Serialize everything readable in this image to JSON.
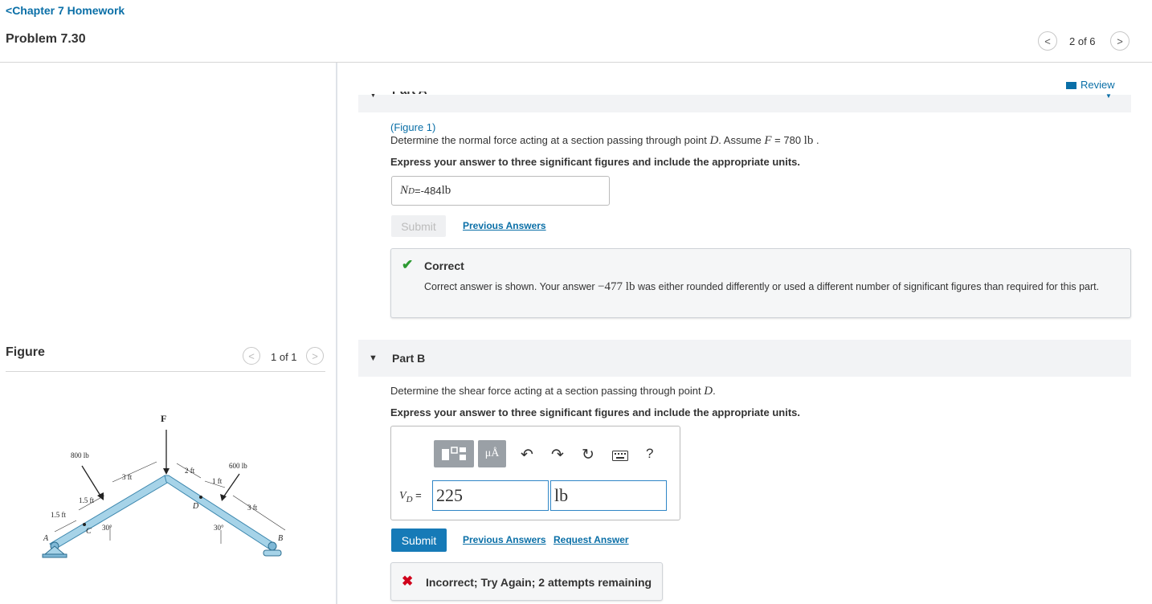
{
  "header": {
    "breadcrumb": "Chapter 7 Homework",
    "problem_title": "Problem 7.30",
    "pagination": "2 of 6"
  },
  "figure_panel": {
    "label": "Figure",
    "count": "1 of 1",
    "diagram_labels": {
      "force_F": "F",
      "load_left": "800 lb",
      "load_right": "600 lb",
      "dim_3ft_left": "3 ft",
      "dim_2ft": "2 ft",
      "dim_1ft": "1 ft",
      "dim_3ft_right": "3 ft",
      "dim_15ft_a": "1.5 ft",
      "dim_15ft_b": "1.5 ft",
      "angle_left": "30°",
      "angle_right": "30°",
      "point_A": "A",
      "point_B": "B",
      "point_C": "C",
      "point_D": "D"
    }
  },
  "review_link": "Review",
  "part_a": {
    "title": "Part A",
    "figure_link": "(Figure 1)",
    "question_pre": "Determine the normal force acting at a section passing through point ",
    "question_point": "D",
    "question_mid": ". Assume ",
    "question_var": "F",
    "question_eq": " = 780 ",
    "question_unit": "lb",
    "question_end": " .",
    "instruction": "Express your answer to three significant figures and include the appropriate units.",
    "answer_symbol": "N",
    "answer_sub": "D",
    "answer_eq": " = ",
    "answer_value": "-484 ",
    "answer_unit": "lb",
    "submit_label": "Submit",
    "previous_answers": "Previous Answers",
    "feedback": {
      "title": "Correct",
      "msg_pre": "Correct answer is shown. Your answer ",
      "msg_value": "−477 lb",
      "msg_post": " was either rounded differently or used a different number of significant figures than required for this part."
    }
  },
  "part_b": {
    "title": "Part B",
    "question_pre": "Determine the shear force acting at a section passing through point ",
    "question_point": "D",
    "question_end": ".",
    "instruction": "Express your answer to three significant figures and include the appropriate units.",
    "units_button": "μÅ",
    "help_label": "?",
    "answer_symbol": "V",
    "answer_sub": "D",
    "answer_eq": " = ",
    "value_input": "225",
    "unit_input": "lb",
    "submit_label": "Submit",
    "previous_answers": "Previous Answers",
    "request_answer": "Request Answer",
    "feedback": "Incorrect; Try Again; 2 attempts remaining"
  },
  "colors": {
    "link": "#0a6fa7",
    "submit_active": "#167ab7",
    "correct_green": "#2d9a33",
    "incorrect_red": "#d0021b",
    "beam_fill": "#a6d3e8"
  }
}
